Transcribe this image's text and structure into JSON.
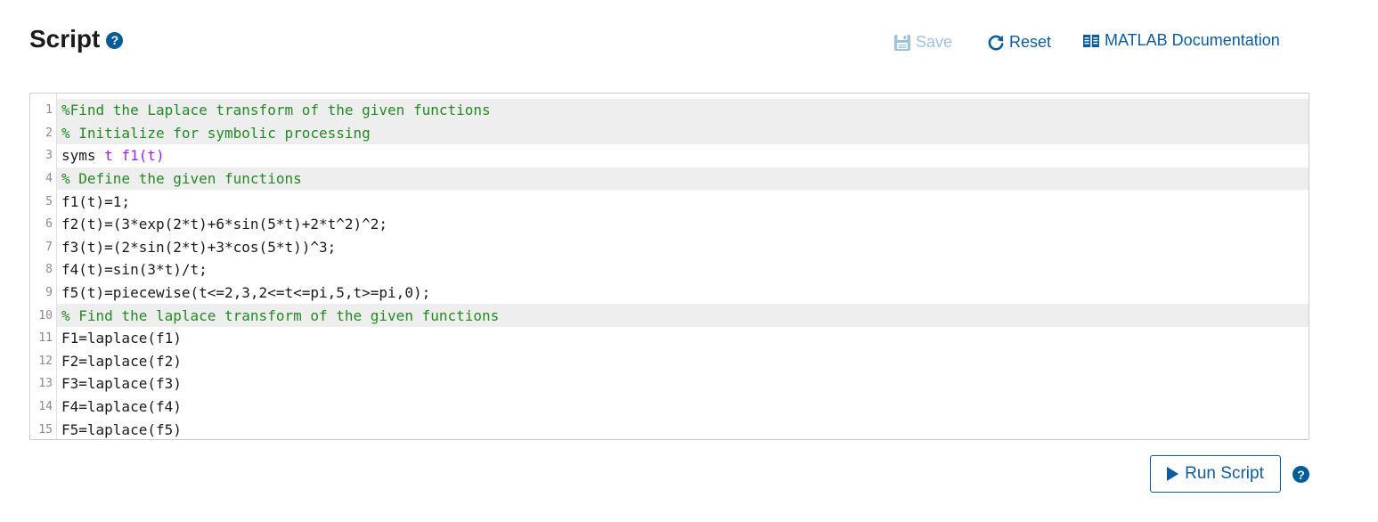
{
  "header": {
    "title": "Script",
    "help_glyph": "?"
  },
  "toolbar": {
    "save_label": "Save",
    "reset_label": "Reset",
    "docs_label": "MATLAB Documentation"
  },
  "editor": {
    "lines": [
      {
        "num": "1",
        "text": "%Find the Laplace transform of the given functions",
        "type": "comment"
      },
      {
        "num": "2",
        "text": "% Initialize for symbolic processing",
        "type": "comment"
      },
      {
        "num": "3",
        "kw": "syms",
        "args": " t f1(t)",
        "type": "syms"
      },
      {
        "num": "4",
        "text": "% Define the given functions",
        "type": "comment"
      },
      {
        "num": "5",
        "text": "f1(t)=1;",
        "type": "code"
      },
      {
        "num": "6",
        "text": "f2(t)=(3*exp(2*t)+6*sin(5*t)+2*t^2)^2;",
        "type": "code"
      },
      {
        "num": "7",
        "text": "f3(t)=(2*sin(2*t)+3*cos(5*t))^3;",
        "type": "code"
      },
      {
        "num": "8",
        "text": "f4(t)=sin(3*t)/t;",
        "type": "code"
      },
      {
        "num": "9",
        "text": "f5(t)=piecewise(t<=2,3,2<=t<=pi,5,t>=pi,0);",
        "type": "code"
      },
      {
        "num": "10",
        "text": "% Find the laplace transform of the given functions",
        "type": "comment"
      },
      {
        "num": "11",
        "text": "F1=laplace(f1)",
        "type": "code"
      },
      {
        "num": "12",
        "text": "F2=laplace(f2)",
        "type": "code"
      },
      {
        "num": "13",
        "text": "F3=laplace(f3)",
        "type": "code"
      },
      {
        "num": "14",
        "text": "F4=laplace(f4)",
        "type": "code"
      },
      {
        "num": "15",
        "text": "F5=laplace(f5)",
        "type": "code"
      }
    ]
  },
  "footer": {
    "run_label": "Run Script",
    "help_glyph": "?"
  },
  "colors": {
    "accent": "#0c5da0",
    "disabled": "#9ec3de",
    "comment": "#228b22",
    "symbol": "#a020f0"
  }
}
